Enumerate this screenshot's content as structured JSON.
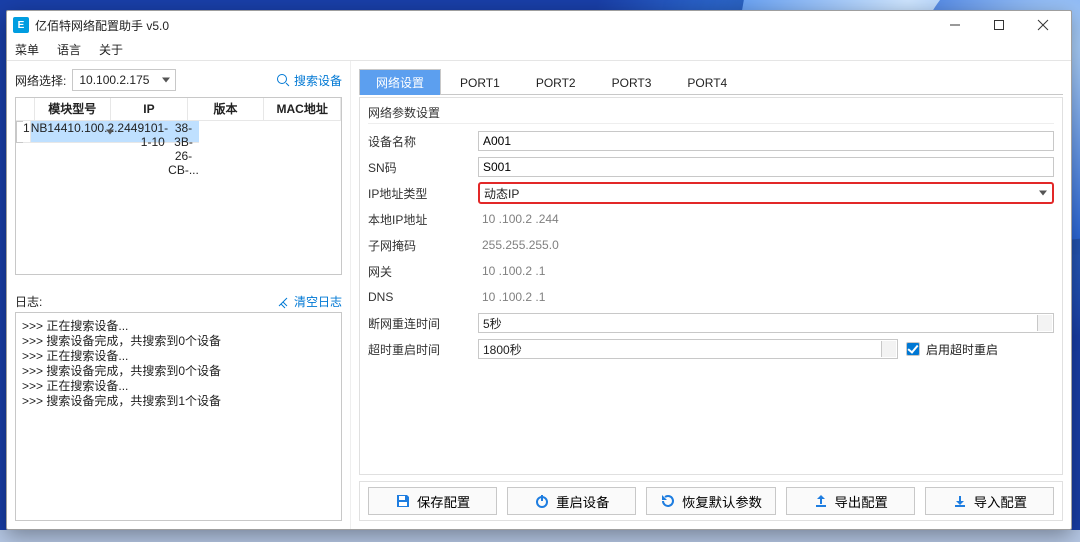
{
  "window": {
    "title": "亿佰特网络配置助手 v5.0"
  },
  "menubar": [
    "菜单",
    "语言",
    "关于"
  ],
  "netselect": {
    "label": "网络选择:",
    "value": "10.100.2.175"
  },
  "search_btn": "搜索设备",
  "dev_table": {
    "cols": [
      "",
      "模块型号",
      "IP",
      "版本",
      "MAC地址"
    ],
    "rows": [
      {
        "idx": "1",
        "model": "NB144",
        "ip": "10.100.2.244",
        "ver": "9101-1-10",
        "mac": "38-3B-26-CB-..."
      }
    ]
  },
  "log": {
    "title": "日志:",
    "clear": "清空日志",
    "lines": [
      ">>> 正在搜索设备...",
      ">>> 搜索设备完成，共搜索到0个设备",
      ">>> 正在搜索设备...",
      ">>> 搜索设备完成，共搜索到0个设备",
      ">>> 正在搜索设备...",
      ">>> 搜索设备完成，共搜索到1个设备"
    ]
  },
  "tabs": [
    "网络设置",
    "PORT1",
    "PORT2",
    "PORT3",
    "PORT4"
  ],
  "net": {
    "section": "网络参数设置",
    "labels": {
      "devname": "设备名称",
      "sn": "SN码",
      "iptype": "IP地址类型",
      "localip": "本地IP地址",
      "mask": "子网掩码",
      "gw": "网关",
      "dns": "DNS",
      "reconn": "断网重连时间",
      "reboot": "超时重启时间"
    },
    "values": {
      "devname": "A001",
      "sn": "S001",
      "iptype": "动态IP",
      "localip": "10 .100.2  .244",
      "mask": "255.255.255.0",
      "gw": "10 .100.2  .1",
      "dns": "10 .100.2  .1",
      "reconn": "5秒",
      "reboot": "1800秒"
    },
    "enable_reboot": "启用超时重启"
  },
  "actions": {
    "save": "保存配置",
    "restart": "重启设备",
    "restore": "恢复默认参数",
    "export": "导出配置",
    "import": "导入配置"
  }
}
